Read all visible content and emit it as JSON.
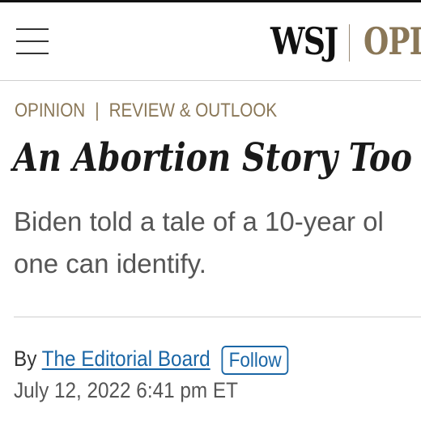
{
  "header": {
    "logo": "WSJ",
    "section_wordmark": "OPIN",
    "menu_icon": "hamburger-menu-icon"
  },
  "flashline": {
    "section": "OPINION",
    "separator": "|",
    "subsection": "REVIEW & OUTLOOK"
  },
  "article": {
    "headline": "An Abortion Story Too",
    "dek_line1": "Biden told a tale of a 10-year ol",
    "dek_line2": "one can identify.",
    "byline_prefix": "By",
    "author": "The Editorial Board",
    "follow_label": "Follow",
    "timestamp": "July 12, 2022 6:41 pm ET"
  },
  "colors": {
    "accent_gold": "#8a7757",
    "link_blue": "#1a66a6",
    "headline_text": "#1a1a1a",
    "dek_text": "#555555"
  }
}
